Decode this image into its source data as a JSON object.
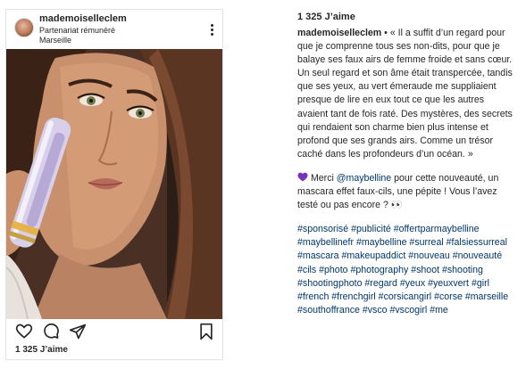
{
  "post": {
    "username": "mademoiselleclem",
    "partnership": "Partenariat rémunéré",
    "location": "Marseille",
    "likes": "1 325 J’aime"
  },
  "caption": {
    "likes": "1 325 J’aime",
    "username": "mademoiselleclem",
    "text": " • « Il a suffit d’un regard pour que je comprenne tous ses non-dits, pour que je balaye ses faux airs de femme froide et sans cœur. Un seul regard et son âme était transpercée, tandis que ses yeux, au vert émeraude me suppliaient presque de lire en eux tout ce que les autres avaient tant de fois raté. Des mystères, des secrets qui rendaient son charme bien plus intense et profond que ses grands airs. Comme un trésor caché dans les profondeurs d’un océan. »",
    "thanks_prefix": " Merci ",
    "mention": "@maybelline",
    "thanks_suffix": " pour cette nouveauté, un mascara effet faux-cils, une pépite ! Vous l’avez testé ou pas encore ? 👀",
    "hashtags": "#sponsorisé #publicité #offertparmaybelline #maybellinefr #maybelline #surreal #falsiessurreal #mascara #makeupaddict #nouveau #nouveauté #cils #photo #photography #shoot #shooting #shootingphoto #regard #yeux #yeuxvert #girl #french #frenchgirl #corsicangirl #corse #marseille #southoffrance #vsco #vscogirl #me"
  },
  "icons": {
    "heart_color": "#7b2fbf",
    "link_color": "#00376b",
    "actions": [
      "heart-icon",
      "comment-icon",
      "share-icon",
      "bookmark-icon"
    ]
  }
}
